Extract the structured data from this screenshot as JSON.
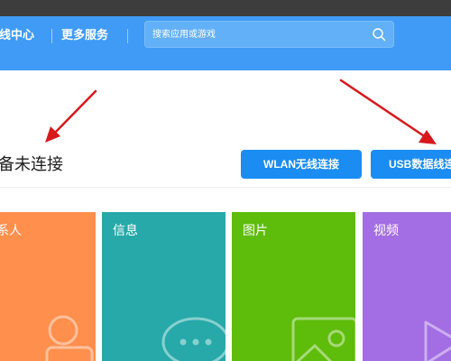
{
  "header": {
    "nav_items": [
      "线中心",
      "更多服务"
    ],
    "search_placeholder": "搜索应用或游戏"
  },
  "connection": {
    "status_text": "备未连接",
    "wlan_button": "WLAN无线连接",
    "usb_button": "USB数据线连"
  },
  "tiles": [
    {
      "label": "系人",
      "color": "#ff8f4d",
      "icon": "contact-icon"
    },
    {
      "label": "信息",
      "color": "#26a9a8",
      "icon": "chat-bubble-icon"
    },
    {
      "label": "图片",
      "color": "#5ebc0a",
      "icon": "picture-icon"
    },
    {
      "label": "视频",
      "color": "#a36de3",
      "icon": "video-play-icon"
    }
  ],
  "colors": {
    "header_bg": "#3f9bf6",
    "button_bg": "#1a8cf2",
    "annotation_arrow": "#d7191c"
  }
}
